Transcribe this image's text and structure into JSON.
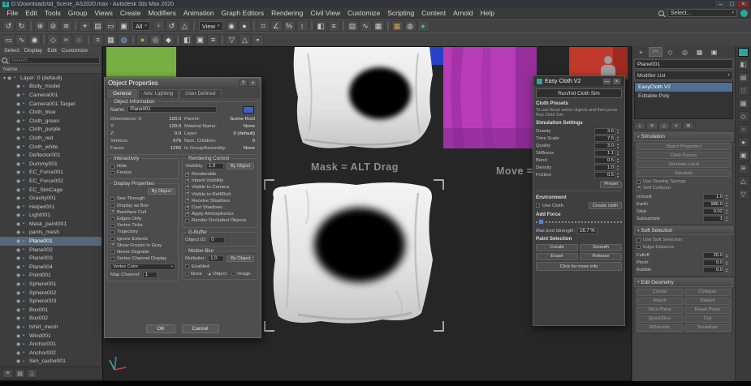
{
  "colors": {
    "accent_blue": "#4f7ab5",
    "selection_blue": "#4f6f94",
    "viewport_bg": "#262626",
    "panel_bg": "#454545",
    "dialog_bg": "#4e4e4e",
    "cloth_white": "#e8e8e8",
    "cloth_magenta": "#b83cb8",
    "cloth_green": "#76b043",
    "cloth_blue": "#2742c8",
    "cloth_red": "#c03526",
    "teal_swatch": "#2aa7a0",
    "object_color": "#3a62c8"
  },
  "titlebar": {
    "logo": "3",
    "title": "D:\\Downloads\\td_Scene_AS2020.max - Autodesk 3ds Max 2020",
    "minimize": "–",
    "maximize": "□",
    "close": "×"
  },
  "menubar": {
    "items": [
      "File",
      "Edit",
      "Tools",
      "Group",
      "Views",
      "Create",
      "Modifiers",
      "Animation",
      "Graph Editors",
      "Rendering",
      "Civil View",
      "Customize",
      "Scripting",
      "Content",
      "Arnold",
      "Help"
    ],
    "workspace_value": "Select..."
  },
  "toolbar_main": {
    "filter_value": "All",
    "coord_value": "View",
    "icons_a": [
      {
        "n": "undo-icon",
        "g": "↺"
      },
      {
        "n": "redo-icon",
        "g": "↻"
      },
      {
        "n": "separator",
        "g": "",
        "cls": "sep"
      },
      {
        "n": "select-and-link-icon",
        "g": "⊕"
      },
      {
        "n": "unlink-selection-icon",
        "g": "⊘"
      },
      {
        "n": "bind-to-space-warp-icon",
        "g": "≋"
      },
      {
        "n": "separator",
        "g": "",
        "cls": "sep"
      },
      {
        "n": "select-object-icon",
        "g": "⌖"
      },
      {
        "n": "select-by-name-icon",
        "g": "▤"
      },
      {
        "n": "rectangular-selection-icon",
        "g": "▭"
      },
      {
        "n": "window-crossing-icon",
        "g": "▣"
      }
    ],
    "icons_b": [
      {
        "n": "select-and-move-icon",
        "g": "+",
        "cls": "blue"
      },
      {
        "n": "select-and-rotate-icon",
        "g": "↺"
      },
      {
        "n": "select-and-scale-icon",
        "g": "△"
      },
      {
        "n": "separator",
        "g": "",
        "cls": "sep"
      }
    ],
    "icons_c": [
      {
        "n": "use-pivot-point-icon",
        "g": "◉"
      },
      {
        "n": "select-and-manipulate-icon",
        "g": "●"
      },
      {
        "n": "separator",
        "g": "",
        "cls": "sep"
      },
      {
        "n": "snaps-toggle-icon",
        "g": "⌗"
      },
      {
        "n": "angle-snap-icon",
        "g": "∠"
      },
      {
        "n": "percent-snap-icon",
        "g": "%"
      },
      {
        "n": "spinner-snap-icon",
        "g": "↕"
      },
      {
        "n": "separator",
        "g": "",
        "cls": "sep"
      },
      {
        "n": "mirror-icon",
        "g": "◧"
      },
      {
        "n": "align-icon",
        "g": "≡"
      },
      {
        "n": "separator",
        "g": "",
        "cls": "sep"
      },
      {
        "n": "layer-manager-icon",
        "g": "▤"
      },
      {
        "n": "curve-editor-icon",
        "g": "∿"
      },
      {
        "n": "schematic-view-icon",
        "g": "▦"
      },
      {
        "n": "separator",
        "g": "",
        "cls": "sep"
      },
      {
        "n": "render-setup-icon",
        "g": "▦",
        "cls": "orange"
      },
      {
        "n": "rendered-frame-icon",
        "g": "◍"
      },
      {
        "n": "render-icon",
        "g": "●",
        "cls": "teal"
      }
    ]
  },
  "toolbar_second": {
    "icons": [
      {
        "n": "modeling-ribbon-icon",
        "g": "▭"
      },
      {
        "n": "freeform-icon",
        "g": "∿"
      },
      {
        "n": "selection-paint-icon",
        "g": "◉"
      },
      {
        "n": "separator",
        "g": "",
        "cls": "sep"
      },
      {
        "n": "polygon-modeling-icon",
        "g": "◇"
      },
      {
        "n": "edge-loop-icon",
        "g": "≈"
      },
      {
        "n": "border-icon",
        "g": "○"
      },
      {
        "n": "separator",
        "g": "",
        "cls": "sep"
      },
      {
        "n": "grid-display-icon",
        "g": "⌗"
      },
      {
        "n": "subdivision-icon",
        "g": "▦"
      },
      {
        "n": "smooth-icon",
        "g": "◍",
        "cls": "blue"
      },
      {
        "n": "separator",
        "g": "",
        "cls": "sep"
      },
      {
        "n": "sculpt-brush-icon",
        "g": "●",
        "cls": "green"
      },
      {
        "n": "relax-brush-icon",
        "g": "◎"
      },
      {
        "n": "pinch-brush-icon",
        "g": "◆"
      },
      {
        "n": "separator",
        "g": "",
        "cls": "sep"
      },
      {
        "n": "mirror-tool-icon",
        "g": "◧"
      },
      {
        "n": "symmetry-icon",
        "g": "▣"
      },
      {
        "n": "align-tool-icon",
        "g": "≡"
      },
      {
        "n": "separator",
        "g": "",
        "cls": "sep"
      },
      {
        "n": "visibility-toggle-icon",
        "g": "▽"
      },
      {
        "n": "isolate-icon",
        "g": "△"
      },
      {
        "n": "lock-selection-icon",
        "g": "▪"
      }
    ]
  },
  "explorer": {
    "menus": [
      "Select",
      "Display",
      "Edit",
      "Customize"
    ],
    "search_placeholder": "Search...",
    "column_header": "Name",
    "items": [
      {
        "name": "Layer: 0 (default)",
        "pad": "2px",
        "g": "▾",
        "cls": ""
      },
      {
        "name": "Body_model",
        "pad": "13px",
        "g": "",
        "cls": ""
      },
      {
        "name": "Camera001",
        "pad": "13px",
        "g": "",
        "cls": ""
      },
      {
        "name": "Camera001.Target",
        "pad": "13px",
        "g": "",
        "cls": ""
      },
      {
        "name": "Cloth_blue",
        "pad": "13px",
        "g": "",
        "cls": ""
      },
      {
        "name": "Cloth_green",
        "pad": "13px",
        "g": "",
        "cls": ""
      },
      {
        "name": "Cloth_purple",
        "pad": "13px",
        "g": "",
        "cls": ""
      },
      {
        "name": "Cloth_red",
        "pad": "13px",
        "g": "",
        "cls": ""
      },
      {
        "name": "Cloth_white",
        "pad": "13px",
        "g": "",
        "cls": ""
      },
      {
        "name": "Deflector001",
        "pad": "13px",
        "g": "",
        "cls": ""
      },
      {
        "name": "Dummy001",
        "pad": "13px",
        "g": "",
        "cls": ""
      },
      {
        "name": "EC_Force001",
        "pad": "13px",
        "g": "",
        "cls": ""
      },
      {
        "name": "EC_Force002",
        "pad": "13px",
        "g": "",
        "cls": ""
      },
      {
        "name": "EC_SimCage",
        "pad": "13px",
        "g": "",
        "cls": ""
      },
      {
        "name": "Gravity001",
        "pad": "13px",
        "g": "",
        "cls": ""
      },
      {
        "name": "Helper001",
        "pad": "13px",
        "g": "",
        "cls": ""
      },
      {
        "name": "Light001",
        "pad": "13px",
        "g": "",
        "cls": ""
      },
      {
        "name": "Mask_paint001",
        "pad": "13px",
        "g": "",
        "cls": ""
      },
      {
        "name": "pants_mesh",
        "pad": "13px",
        "g": "",
        "cls": ""
      },
      {
        "name": "Plane001",
        "pad": "13px",
        "g": "",
        "cls": "selected"
      },
      {
        "name": "Plane002",
        "pad": "13px",
        "g": "",
        "cls": ""
      },
      {
        "name": "Plane003",
        "pad": "13px",
        "g": "",
        "cls": ""
      },
      {
        "name": "Plane004",
        "pad": "13px",
        "g": "",
        "cls": ""
      },
      {
        "name": "Point001",
        "pad": "13px",
        "g": "",
        "cls": ""
      },
      {
        "name": "Sphere001",
        "pad": "13px",
        "g": "",
        "cls": ""
      },
      {
        "name": "Sphere002",
        "pad": "13px",
        "g": "",
        "cls": ""
      },
      {
        "name": "Sphere003",
        "pad": "13px",
        "g": "",
        "cls": ""
      },
      {
        "name": "Box001",
        "pad": "13px",
        "g": "",
        "cls": ""
      },
      {
        "name": "Box002",
        "pad": "13px",
        "g": "",
        "cls": ""
      },
      {
        "name": "tshirt_mesh",
        "pad": "13px",
        "g": "",
        "cls": ""
      },
      {
        "name": "Wind001",
        "pad": "13px",
        "g": "",
        "cls": ""
      },
      {
        "name": "Anchor001",
        "pad": "13px",
        "g": "",
        "cls": ""
      },
      {
        "name": "Anchor002",
        "pad": "13px",
        "g": "",
        "cls": ""
      },
      {
        "name": "Sim_cache001",
        "pad": "13px",
        "g": "",
        "cls": ""
      }
    ],
    "footer_icons": [
      {
        "n": "explorer-settings-icon",
        "g": "≡"
      },
      {
        "n": "explorer-filter-icon",
        "g": "▤"
      },
      {
        "n": "explorer-pin-icon",
        "g": "⊥"
      }
    ]
  },
  "viewport": {
    "overlay_mask": "Mask = ALT Drag",
    "overlay_move": "Move = Drag",
    "axis_x": "x",
    "axis_y": "y",
    "axis_z": "z"
  },
  "object_properties": {
    "title": "Object Properties",
    "help": "?",
    "close": "×",
    "tabs": [
      {
        "label": "General",
        "cls": "active"
      },
      {
        "label": "Adv. Lighting",
        "cls": ""
      },
      {
        "label": "User Defined",
        "cls": ""
      }
    ],
    "info_title": "Object Information",
    "name_label": "Name:",
    "name_value": "Plane001",
    "rows_left": [
      {
        "label": "Dimensions: X:",
        "value": "120.0"
      },
      {
        "label": "Y:",
        "value": "120.0"
      },
      {
        "label": "Z:",
        "value": "0.0"
      },
      {
        "label": "Vertices:",
        "value": "676"
      },
      {
        "label": "Faces:",
        "value": "1250"
      }
    ],
    "rows_right": [
      {
        "label": "Parent:",
        "value": "Scene Root"
      },
      {
        "label": "Material Name:",
        "value": "None"
      },
      {
        "label": "Layer:",
        "value": "0 (default)"
      },
      {
        "label": "Num. Children:",
        "value": "0"
      },
      {
        "label": "In Group/Assembly:",
        "value": "None"
      }
    ],
    "interactivity_title": "Interactivity",
    "interactivity_checks": [
      {
        "label": "Hide",
        "cls": ""
      },
      {
        "label": "Freeze",
        "cls": ""
      }
    ],
    "display_title": "Display Properties",
    "display_byobject": "By Object",
    "display_checks": [
      {
        "label": "See-Through",
        "cls": ""
      },
      {
        "label": "Display as Box",
        "cls": ""
      },
      {
        "label": "Backface Cull",
        "cls": "checked"
      },
      {
        "label": "Edges Only",
        "cls": ""
      },
      {
        "label": "Vertex Ticks",
        "cls": ""
      },
      {
        "label": "Trajectory",
        "cls": ""
      },
      {
        "label": "Ignore Extents",
        "cls": ""
      },
      {
        "label": "Show Frozen in Gray",
        "cls": "checked"
      },
      {
        "label": "Never Degrade",
        "cls": ""
      },
      {
        "label": "Vertex Channel Display",
        "cls": ""
      }
    ],
    "vertex_channel_value": "Vertex Color",
    "map_channel_label": "Map Channel:",
    "map_channel_value": "1",
    "render_title": "Rendering Control",
    "visibility_label": "Visibility:",
    "visibility_value": "1.0",
    "render_byobject": "By Object",
    "render_checks": [
      {
        "label": "Renderable",
        "cls": "checked"
      },
      {
        "label": "Inherit Visibility",
        "cls": "checked"
      },
      {
        "label": "Visible to Camera",
        "cls": "checked"
      },
      {
        "label": "Visible to Refl/Refr",
        "cls": "checked"
      },
      {
        "label": "Receive Shadows",
        "cls": "checked"
      },
      {
        "label": "Cast Shadows",
        "cls": "checked"
      },
      {
        "label": "Apply Atmospherics",
        "cls": "checked"
      },
      {
        "label": "Render Occluded Objects",
        "cls": ""
      }
    ],
    "gbuffer_title": "G-Buffer",
    "object_id_label": "Object ID:",
    "object_id_value": "0",
    "mb_title": "Motion Blur",
    "multiplier_label": "Multiplier:",
    "multiplier_value": "1.0",
    "mb_byobject": "By Object",
    "enabled_label": "Enabled",
    "mb_options": [
      {
        "label": "None",
        "cls": ""
      },
      {
        "label": "Object",
        "cls": "checked"
      },
      {
        "label": "Image",
        "cls": ""
      }
    ],
    "ok": "OK",
    "cancel": "Cancel"
  },
  "easycloth": {
    "title": "Easy Cloth V2",
    "collapse": "—",
    "close": "×",
    "run_button": "Run/Init Cloth Sim",
    "presets_title": "Cloth Presets",
    "presets_text": "To use these select objects and then press Run Cloth Sim",
    "sim_title": "Simulation Settings",
    "params": [
      {
        "label": "Gravity",
        "value": "3.6"
      },
      {
        "label": "Time Scale",
        "value": "7.5"
      },
      {
        "label": "Quality",
        "value": "3.0"
      },
      {
        "label": "Stiffness",
        "value": "1.1"
      },
      {
        "label": "Bend",
        "value": "0.5"
      },
      {
        "label": "Density",
        "value": "1.0"
      },
      {
        "label": "Friction",
        "value": "0.5"
      }
    ],
    "preset_button": "Preset",
    "env_title": "Environment",
    "use_cloth_label": "Use Cloth",
    "create_cloth_button": "Create cloth",
    "add_force_label": "Add Force",
    "strength_label": "Max End Strength:",
    "strength_value": "16.7 %",
    "paint_title": "Paint Selection",
    "paint_buttons": [
      "Create",
      "Smooth",
      "Erase",
      "Release"
    ],
    "info_button": "Click for more info"
  },
  "command_panel": {
    "tabs": [
      {
        "n": "create-tab-icon",
        "g": "+",
        "cls": ""
      },
      {
        "n": "modify-tab-icon",
        "g": "◠",
        "cls": "active"
      },
      {
        "n": "hierarchy-tab-icon",
        "g": "◇",
        "cls": ""
      },
      {
        "n": "motion-tab-icon",
        "g": "◎",
        "cls": ""
      },
      {
        "n": "display-tab-icon",
        "g": "▦",
        "cls": ""
      },
      {
        "n": "utilities-tab-icon",
        "g": "▣",
        "cls": ""
      }
    ],
    "name_value": "Plane001",
    "modifier_list_label": "Modifier List",
    "stack": [
      {
        "label": "EasyCloth V2",
        "cls": "selected"
      },
      {
        "label": "Editable Poly",
        "cls": ""
      }
    ],
    "stack_tools": [
      {
        "n": "pin-stack-icon",
        "g": "⊥"
      },
      {
        "n": "show-end-result-icon",
        "g": "≡"
      },
      {
        "n": "make-unique-icon",
        "g": "◇"
      },
      {
        "n": "remove-modifier-icon",
        "g": "×"
      },
      {
        "n": "configure-modifier-sets-icon",
        "g": "≋"
      }
    ],
    "rollout1": {
      "title": "Simulation",
      "buttons": [
        "Object Properties",
        "Cloth Forces",
        "Simulate Local",
        "Simulate"
      ],
      "checks": [
        {
          "label": "Use Sewing Springs",
          "cls": ""
        },
        {
          "label": "Self Collision",
          "cls": "checked"
        }
      ],
      "spinners": [
        {
          "label": "cm/unit",
          "value": "1.0"
        },
        {
          "label": "Earth",
          "value": "980.0"
        },
        {
          "label": "Step",
          "value": "0.02"
        },
        {
          "label": "Subsample",
          "value": "1"
        }
      ]
    },
    "rollout2": {
      "title": "Soft Selection",
      "checks": [
        {
          "label": "Use Soft Selection",
          "cls": ""
        },
        {
          "label": "Edge Distance",
          "cls": ""
        }
      ],
      "spinners": [
        {
          "label": "Falloff",
          "value": "20.0"
        },
        {
          "label": "Pinch",
          "value": "0.0"
        },
        {
          "label": "Bubble",
          "value": "0.0"
        }
      ]
    },
    "rollout3": {
      "title": "Edit Geometry",
      "pairs": [
        [
          "Create",
          "Collapse"
        ],
        [
          "Attach",
          "Detach"
        ],
        [
          "Slice Plane",
          "Reset Plane"
        ],
        [
          "QuickSlice",
          "Cut"
        ]
      ],
      "buttons": [
        "MSmooth",
        "Tessellate"
      ]
    }
  },
  "right_strip": {
    "icons": [
      {
        "n": "viewport-layout-icon",
        "g": "◧"
      },
      {
        "n": "maximize-viewport-icon",
        "g": "▤"
      },
      {
        "n": "isolate-selection-icon",
        "g": "□"
      },
      {
        "n": "grid-toggle-icon",
        "g": "▦"
      },
      {
        "n": "gizmo-toggle-icon",
        "g": "◇"
      },
      {
        "n": "orbit-icon",
        "g": "○"
      },
      {
        "n": "pan-icon",
        "g": "●"
      },
      {
        "n": "zoom-extents-icon",
        "g": "▣"
      },
      {
        "n": "wave-deform-icon",
        "g": "≋"
      },
      {
        "n": "up-arrow-icon",
        "g": "△"
      },
      {
        "n": "down-arrow-icon",
        "g": "▽"
      }
    ]
  }
}
